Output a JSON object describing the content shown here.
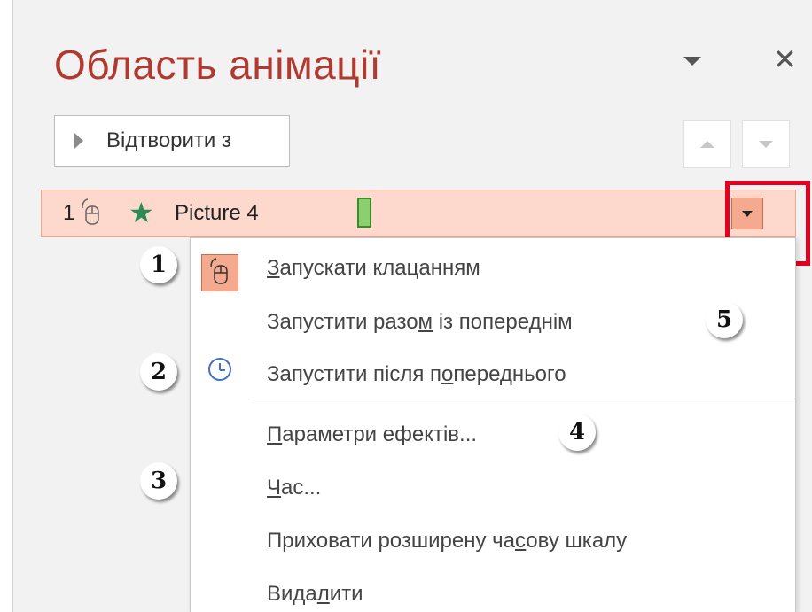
{
  "pane": {
    "title": "Область анімації",
    "play_button_label": "Відтворити з"
  },
  "animation_item": {
    "number": "1",
    "name": "Picture 4",
    "effect_icon": "star-icon",
    "trigger_icon": "mouse-icon"
  },
  "menu": {
    "items": [
      {
        "before": "",
        "key": "З",
        "after": "апускати клацанням",
        "icon": "mouse-icon",
        "selected": true
      },
      {
        "before": "Запустити разо",
        "key": "м",
        "after": " із попереднім",
        "icon": ""
      },
      {
        "before": "Запустити після п",
        "key": "о",
        "after": "переднього",
        "icon": "clock-icon"
      },
      {
        "before": "",
        "key": "П",
        "after": "араметри ефектів...",
        "icon": ""
      },
      {
        "before": "",
        "key": "Ч",
        "after": "ас...",
        "icon": ""
      },
      {
        "before": "Приховати розширену ча",
        "key": "с",
        "after": "ову шкалу",
        "icon": ""
      },
      {
        "before": "Вида",
        "key": "л",
        "after": "ити",
        "icon": ""
      }
    ]
  },
  "callouts": [
    "1",
    "2",
    "3",
    "4",
    "5"
  ],
  "colors": {
    "title": "#b03a30",
    "selection": "#fcd9cc",
    "highlight_box": "#e6001f",
    "star": "#2e8b57",
    "timeline_bar": "#8ccf6d"
  }
}
